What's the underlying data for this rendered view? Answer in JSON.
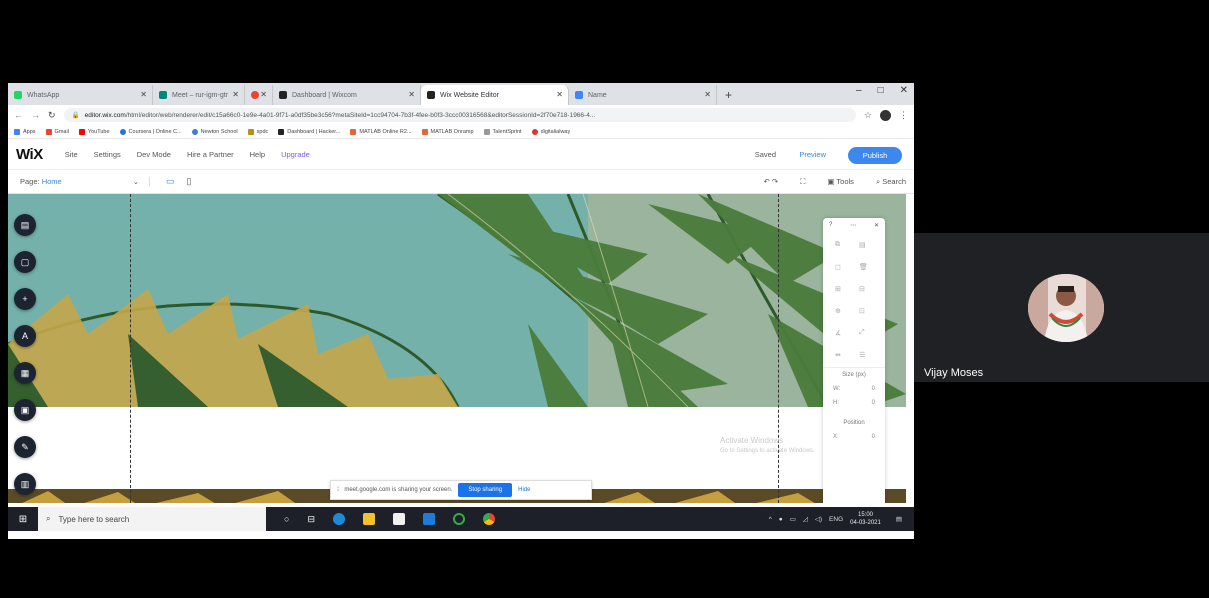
{
  "browser": {
    "tabs": [
      {
        "label": "WhatsApp",
        "color": "#25d366"
      },
      {
        "label": "Meet – rur-igm-gtr",
        "color": "#00897b"
      },
      {
        "label": "",
        "color": "#ea4335"
      },
      {
        "label": "Dashboard | Wixcom",
        "color": "#222222"
      },
      {
        "label": "Wix Website Editor",
        "color": "#222222"
      },
      {
        "label": "Name",
        "color": "#4285f4"
      }
    ],
    "new_tab": "+",
    "window_controls": {
      "minimize": "–",
      "maximize": "□",
      "close": "✕"
    },
    "url_domain": "editor.wix.com",
    "url_path": "/html/editor/web/renderer/edit/c15a66c0-1e9e-4a01-9f71-a0df35be3c56?metaSiteId=1cc94704-7b3f-4fee-b0f3-3ccc00316568&editorSessionId=2f70e718-1966-4...",
    "bookmarks": [
      "Apps",
      "Gmail",
      "YouTube",
      "Coursera | Online C...",
      "Newton School",
      "spdc",
      "Dashboard | Hacker...",
      "MATLAB Online R2...",
      "MATLAB Onramp",
      "TalentSprint",
      "digitalialway"
    ]
  },
  "wix": {
    "logo": "WiX",
    "menu": [
      "Site",
      "Settings",
      "Dev Mode",
      "Hire a Partner",
      "Help",
      "Upgrade"
    ],
    "saved": "Saved",
    "preview": "Preview",
    "publish": "Publish",
    "page_label": "Page:",
    "page_value": "Home",
    "tools_label": "Tools",
    "search_label": "Search",
    "panel": {
      "size_label": "Size (px)",
      "w_label": "W:",
      "h_label": "H:",
      "w_value": "0",
      "h_value": "0",
      "position_label": "Position",
      "x_label": "X:",
      "x_value": "0"
    }
  },
  "watermark": {
    "title": "Activate Windows",
    "subtitle": "Go to Settings to activate Windows."
  },
  "share_bar": {
    "message": "meet.google.com is sharing your screen.",
    "stop": "Stop sharing",
    "hide": "Hide"
  },
  "taskbar": {
    "search_placeholder": "Type here to search",
    "lang": "ENG",
    "time": "15:00",
    "date": "04-03-2021"
  },
  "participant": {
    "name": "Vijay Moses"
  }
}
